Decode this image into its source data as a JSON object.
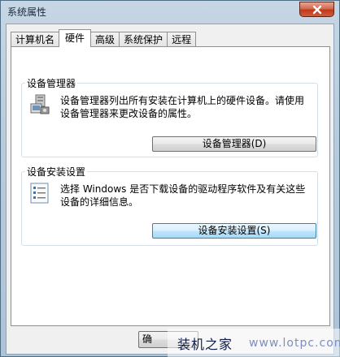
{
  "window": {
    "title": "系统属性"
  },
  "tabs": [
    {
      "label": "计算机名",
      "active": false
    },
    {
      "label": "硬件",
      "active": true
    },
    {
      "label": "高级",
      "active": false
    },
    {
      "label": "系统保护",
      "active": false
    },
    {
      "label": "远程",
      "active": false
    }
  ],
  "device_manager": {
    "heading": "设备管理器",
    "description": "设备管理器列出所有安装在计算机上的硬件设备。请使用设备管理器来更改设备的属性。",
    "button_label": "设备管理器(D)",
    "icon": "device-manager-icon"
  },
  "device_install": {
    "heading": "设备安装设置",
    "description": "选择 Windows 是否下载设备的驱动程序软件及有关这些设备的详细信息。",
    "button_label": "设备安装设置(S)",
    "icon": "checklist-icon"
  },
  "footer": {
    "ok_label": "确"
  },
  "watermark": {
    "text": "装机之家",
    "url": "www.lotpc.com"
  },
  "colors": {
    "close_button": "#c0391c",
    "accent": "#3c7fb1"
  }
}
